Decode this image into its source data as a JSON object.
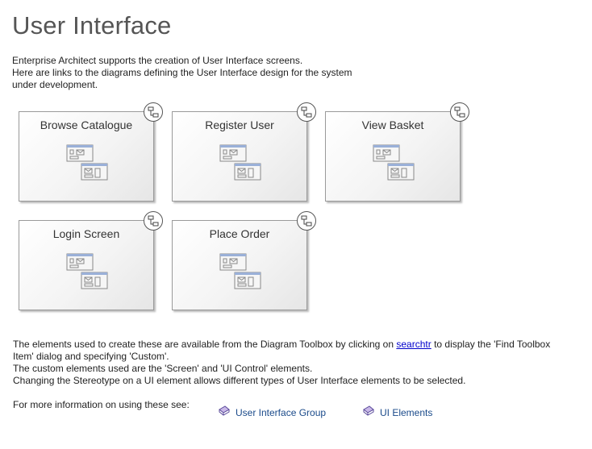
{
  "title": "User Interface",
  "intro": {
    "line1": "Enterprise Architect supports the creation of User Interface screens.",
    "line2": "Here are links to the diagrams defining the User Interface design for the system",
    "line3": "under development."
  },
  "cards": [
    {
      "label": "Browse Catalogue",
      "icon": "diagram-link-icon"
    },
    {
      "label": "Register User",
      "icon": "diagram-link-icon"
    },
    {
      "label": "View Basket",
      "icon": "diagram-link-icon"
    },
    {
      "label": "Login Screen",
      "icon": "diagram-link-icon"
    },
    {
      "label": "Place Order",
      "icon": "diagram-link-icon"
    }
  ],
  "info": {
    "line1_before": "The elements used to create these are available from the Diagram Toolbox by clicking on ",
    "line1_link": "searchtr",
    "line1_after": " to display the 'Find Toolbox",
    "line2": "Item' dialog and specifying 'Custom'.",
    "line3": "The custom elements used are the 'Screen' and 'UI Control' elements.",
    "line4": "Changing the Stereotype on a UI element allows different types of User Interface elements to be selected."
  },
  "more": {
    "label": "For more information on using these see:",
    "links": [
      {
        "label": "User Interface Group",
        "icon": "help-book-icon"
      },
      {
        "label": "UI Elements",
        "icon": "help-book-icon"
      }
    ]
  },
  "colors": {
    "link": "#1a4a8a",
    "hyperlink": "#0000cc",
    "card_border": "#9a9a9a"
  }
}
